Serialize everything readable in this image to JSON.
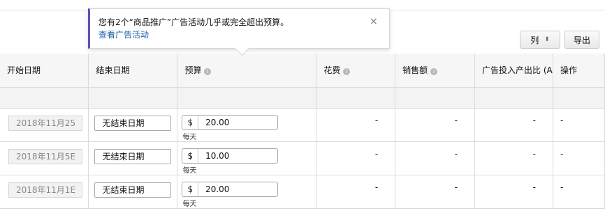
{
  "toolbar": {
    "columns_label": "列",
    "columns_chevron": "⬍",
    "export_label": "导出"
  },
  "popover": {
    "message": "您有2个“商品推广”广告活动几乎或完全超出预算。",
    "link": "查看广告活动",
    "close_glyph": "×",
    "accent_color": "#5b53b6"
  },
  "table": {
    "headers": {
      "start_date": "开始日期",
      "end_date": "结束日期",
      "budget": "预算",
      "spend": "花费",
      "sales": "销售额",
      "acos": "广告投入产出比 (A",
      "actions": "操作"
    },
    "info_glyph": "i",
    "rows": [
      {
        "start_date": "2018年11月25",
        "end_date": "无结束日期",
        "currency": "$",
        "budget": "20.00",
        "budget_period": "每天",
        "spend": "-",
        "sales": "-",
        "acos": "-",
        "actions": "-"
      },
      {
        "start_date": "2018年11月5E",
        "end_date": "无结束日期",
        "currency": "$",
        "budget": "10.00",
        "budget_period": "每天",
        "spend": "-",
        "sales": "-",
        "acos": "-",
        "actions": "-"
      },
      {
        "start_date": "2018年11月1E",
        "end_date": "无结束日期",
        "currency": "$",
        "budget": "20.00",
        "budget_period": "每天",
        "spend": "-",
        "sales": "-",
        "acos": "-",
        "actions": "-"
      }
    ]
  }
}
